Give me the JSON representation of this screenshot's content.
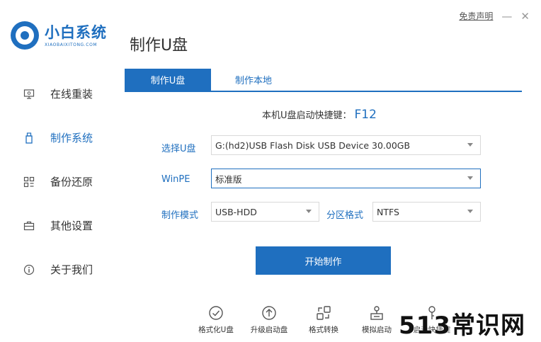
{
  "app": {
    "logo_cn": "小白系统",
    "logo_en": "XIAOBAIXITONG.COM",
    "page_title": "制作U盘",
    "disclaimer": "免责声明",
    "minimize_glyph": "—",
    "close_glyph": "✕"
  },
  "sidebar": {
    "items": [
      {
        "label": "在线重装",
        "icon": "monitor-icon",
        "active": false
      },
      {
        "label": "制作系统",
        "icon": "usb-icon",
        "active": true
      },
      {
        "label": "备份还原",
        "icon": "grid-icon",
        "active": false
      },
      {
        "label": "其他设置",
        "icon": "briefcase-icon",
        "active": false
      },
      {
        "label": "关于我们",
        "icon": "info-icon",
        "active": false
      }
    ]
  },
  "tabs": [
    {
      "label": "制作U盘",
      "active": true
    },
    {
      "label": "制作本地",
      "active": false
    }
  ],
  "hotkey": {
    "label": "本机U盘启动快捷键：",
    "key": "F12"
  },
  "form": {
    "usb_label": "选择U盘",
    "usb_value": "G:(hd2)USB Flash Disk USB Device 30.00GB",
    "winpe_label": "WinPE",
    "winpe_value": "标准版",
    "mode_label": "制作模式",
    "mode_value": "USB-HDD",
    "partition_label": "分区格式",
    "partition_value": "NTFS"
  },
  "start_button": "开始制作",
  "tools": [
    {
      "label": "格式化U盘",
      "icon": "check-circle-icon"
    },
    {
      "label": "升级启动盘",
      "icon": "arrow-up-circle-icon"
    },
    {
      "label": "格式转换",
      "icon": "convert-icon"
    },
    {
      "label": "模拟启动",
      "icon": "simulate-icon"
    },
    {
      "label": "启动快捷键",
      "icon": "key-icon"
    }
  ],
  "watermark": "513常识网",
  "colors": {
    "accent": "#1f6fbf",
    "text": "#333333"
  }
}
